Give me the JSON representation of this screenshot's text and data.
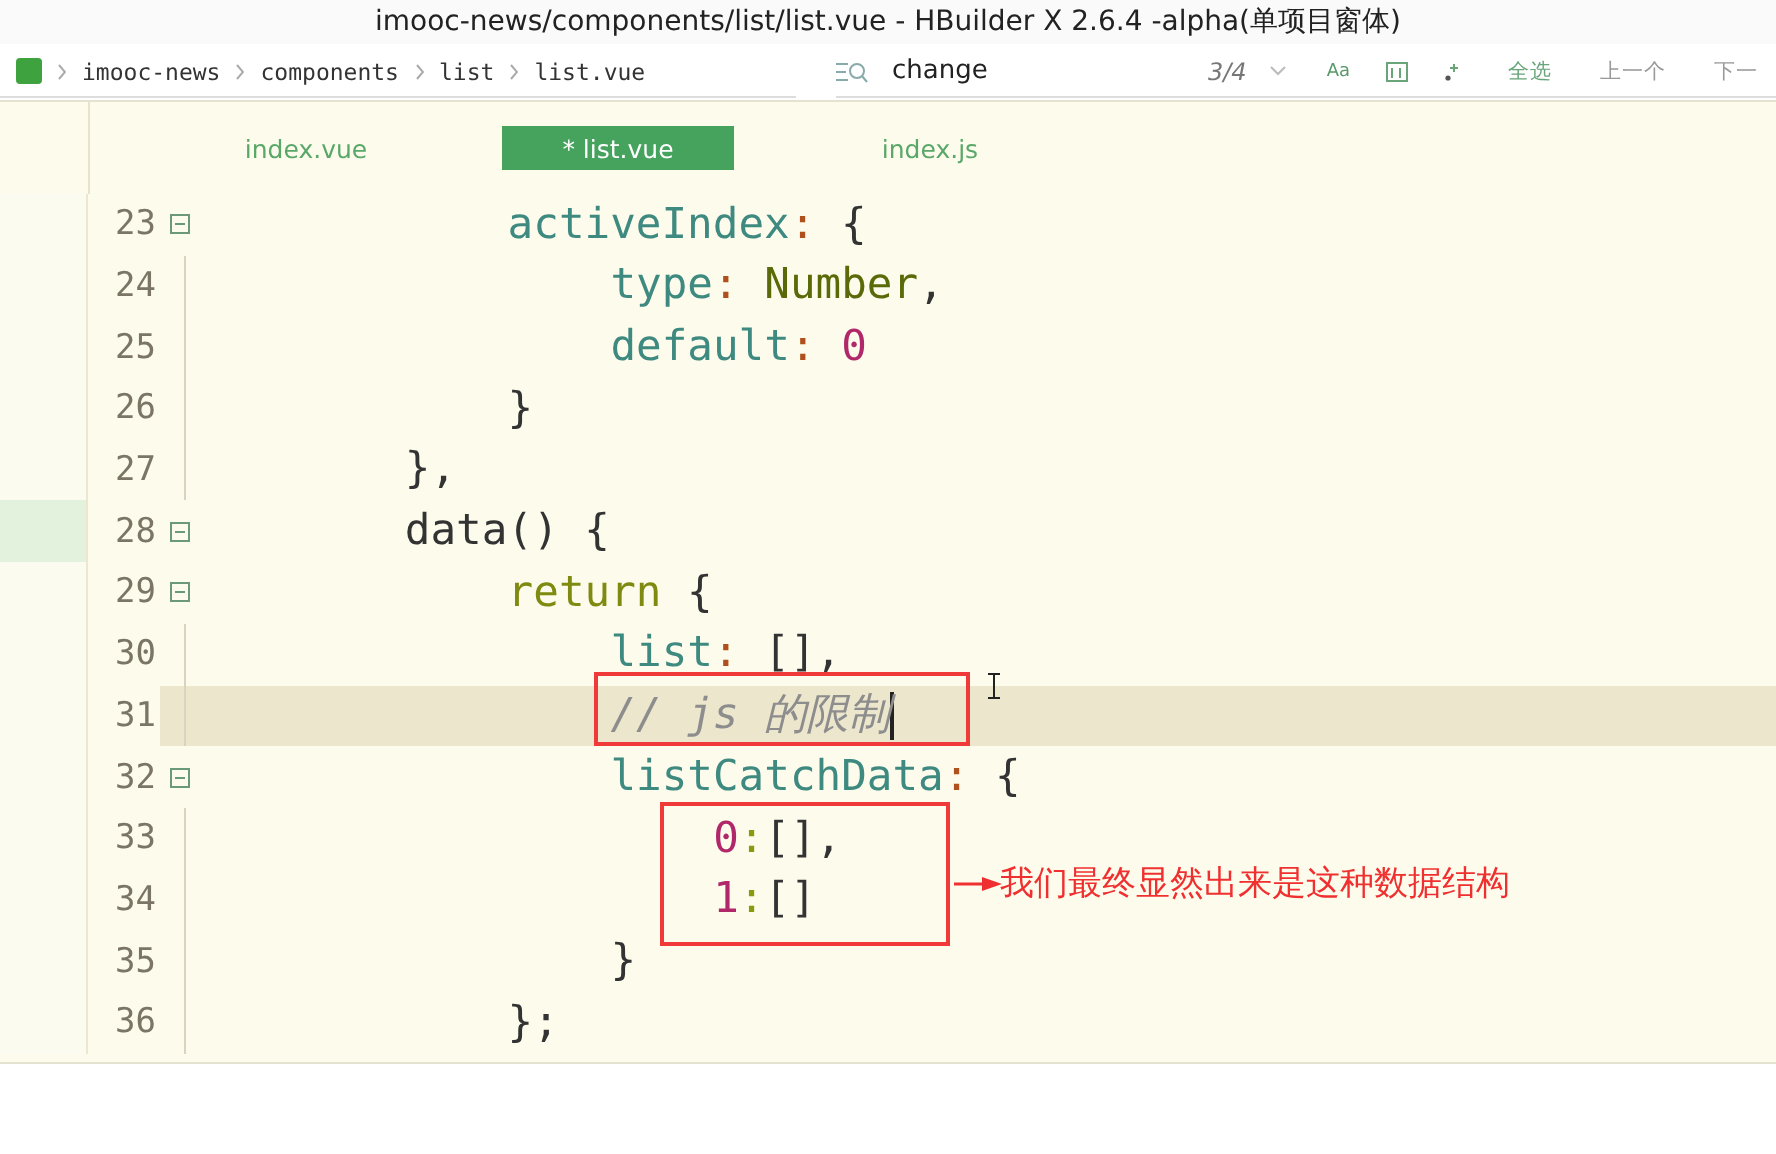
{
  "window": {
    "title": "imooc-news/components/list/list.vue - HBuilder X 2.6.4 -alpha(单项目窗体)"
  },
  "breadcrumb": [
    "imooc-news",
    "components",
    "list",
    "list.vue"
  ],
  "find_bar": {
    "value": "change",
    "count": "3/4",
    "match_case": "Aa",
    "select_all": "全选",
    "previous": "上一个",
    "next": "下一"
  },
  "tabs": [
    {
      "label": "index.vue",
      "selected": false
    },
    {
      "label": "* list.vue",
      "selected": true
    },
    {
      "label": "index.js",
      "selected": false
    }
  ],
  "code_lines": [
    {
      "number": "23",
      "foldable": true,
      "current": false,
      "marked": false,
      "tokens": [
        {
          "kind": "prop",
          "text": "activeIndex"
        },
        {
          "kind": "colon",
          "text": ":"
        },
        {
          "kind": "plain",
          "text": " {"
        }
      ]
    },
    {
      "number": "24",
      "foldable": false,
      "current": false,
      "marked": false,
      "tokens": [
        {
          "kind": "prop",
          "text": "type"
        },
        {
          "kind": "colon",
          "text": ":"
        },
        {
          "kind": "type",
          "text": " Number"
        },
        {
          "kind": "plain",
          "text": ","
        }
      ]
    },
    {
      "number": "25",
      "foldable": false,
      "current": false,
      "marked": false,
      "tokens": [
        {
          "kind": "prop",
          "text": "default"
        },
        {
          "kind": "colon",
          "text": ":"
        },
        {
          "kind": "number",
          "text": " 0"
        }
      ]
    },
    {
      "number": "26",
      "foldable": false,
      "current": false,
      "marked": false,
      "tokens": [
        {
          "kind": "plain",
          "text": "}"
        }
      ]
    },
    {
      "number": "27",
      "foldable": false,
      "current": false,
      "marked": false,
      "tokens": [
        {
          "kind": "plain",
          "text": "},"
        }
      ]
    },
    {
      "number": "28",
      "foldable": true,
      "current": false,
      "marked": true,
      "tokens": [
        {
          "kind": "plain",
          "text": "data() {"
        }
      ]
    },
    {
      "number": "29",
      "foldable": true,
      "current": false,
      "marked": false,
      "tokens": [
        {
          "kind": "keyword",
          "text": "return"
        },
        {
          "kind": "plain",
          "text": " {"
        }
      ]
    },
    {
      "number": "30",
      "foldable": false,
      "current": false,
      "marked": false,
      "tokens": [
        {
          "kind": "prop",
          "text": "list"
        },
        {
          "kind": "colon",
          "text": ":"
        },
        {
          "kind": "plain",
          "text": " [],"
        }
      ]
    },
    {
      "number": "31",
      "foldable": false,
      "current": true,
      "marked": false,
      "tokens": [
        {
          "kind": "comment",
          "text": "// js 的限制"
        }
      ]
    },
    {
      "number": "32",
      "foldable": true,
      "current": false,
      "marked": false,
      "tokens": [
        {
          "kind": "prop",
          "text": "listCatchData"
        },
        {
          "kind": "colon",
          "text": ":"
        },
        {
          "kind": "plain",
          "text": " {"
        }
      ]
    },
    {
      "number": "33",
      "foldable": false,
      "current": false,
      "marked": false,
      "tokens": [
        {
          "kind": "number",
          "text": "0"
        },
        {
          "kind": "typecolon",
          "text": ":"
        },
        {
          "kind": "plain",
          "text": "[],"
        }
      ]
    },
    {
      "number": "34",
      "foldable": false,
      "current": false,
      "marked": false,
      "tokens": [
        {
          "kind": "number",
          "text": "1"
        },
        {
          "kind": "typecolon",
          "text": ":"
        },
        {
          "kind": "plain",
          "text": "[]"
        }
      ]
    },
    {
      "number": "35",
      "foldable": false,
      "current": false,
      "marked": false,
      "tokens": [
        {
          "kind": "plain",
          "text": "}"
        }
      ]
    },
    {
      "number": "36",
      "foldable": false,
      "current": false,
      "marked": false,
      "tokens": [
        {
          "kind": "plain",
          "text": "};"
        }
      ]
    }
  ],
  "annotation": {
    "note": "我们最终显然出来是这种数据结构"
  }
}
